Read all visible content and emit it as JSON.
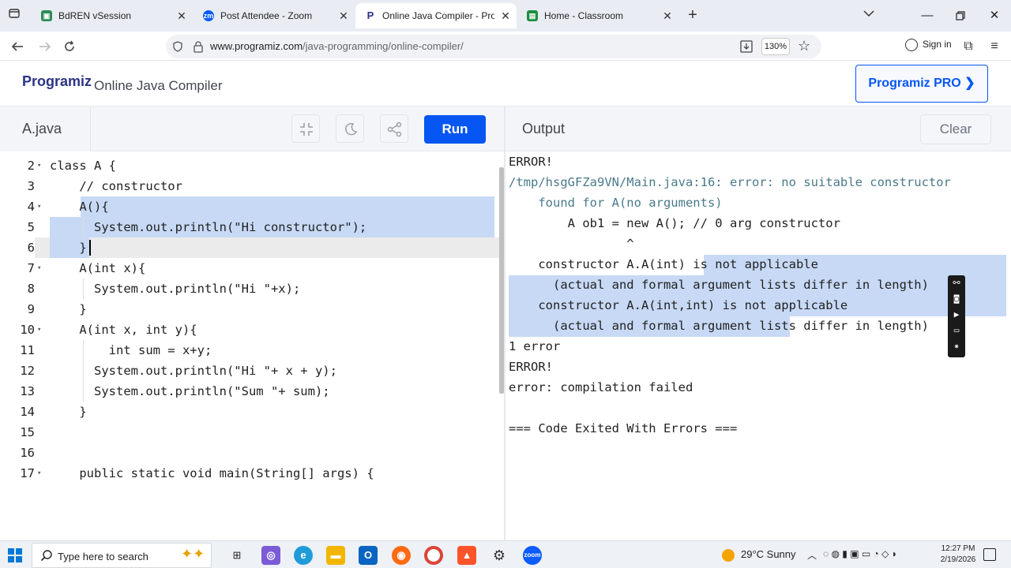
{
  "browser": {
    "tabs": [
      {
        "title": "BdREN vSession",
        "icon": "bdren-favicon-icon",
        "active": false,
        "color": "#2e8b57"
      },
      {
        "title": "Post Attendee - Zoom",
        "icon": "zoom-favicon-icon",
        "active": false,
        "color": "#0b5cff"
      },
      {
        "title": "Online Java Compiler - Programiz",
        "icon": "programiz-favicon-icon",
        "active": true,
        "color": "#2b3486"
      },
      {
        "title": "Home - Classroom",
        "icon": "classroom-favicon-icon",
        "active": false,
        "color": "#1e8e3e"
      }
    ],
    "url_domain": "www.programiz.com",
    "url_path": "/java-programming/online-compiler/",
    "zoom": "130%",
    "signin_label": "Sign in"
  },
  "site": {
    "logo": "Programiz",
    "title": "Online Java Compiler",
    "pro_button": "Programiz PRO ❯",
    "accent": "#0556f3"
  },
  "editor": {
    "filename": "A.java",
    "run_label": "Run",
    "lines": [
      {
        "num": "2",
        "fold": true,
        "text": "class A {"
      },
      {
        "num": "3",
        "fold": false,
        "text": "    // constructor"
      },
      {
        "num": "4",
        "fold": true,
        "text": "    A(){"
      },
      {
        "num": "5",
        "fold": false,
        "text": "      System.out.println(\"Hi constructor\");"
      },
      {
        "num": "6",
        "fold": false,
        "text": "    }"
      },
      {
        "num": "7",
        "fold": true,
        "text": "    A(int x){"
      },
      {
        "num": "8",
        "fold": false,
        "text": "      System.out.println(\"Hi \"+x);"
      },
      {
        "num": "9",
        "fold": false,
        "text": "    }"
      },
      {
        "num": "10",
        "fold": true,
        "text": "    A(int x, int y){"
      },
      {
        "num": "11",
        "fold": false,
        "text": "        int sum = x+y;"
      },
      {
        "num": "12",
        "fold": false,
        "text": "      System.out.println(\"Hi \"+ x + y);"
      },
      {
        "num": "13",
        "fold": false,
        "text": "      System.out.println(\"Sum \"+ sum);"
      },
      {
        "num": "14",
        "fold": false,
        "text": "    }"
      },
      {
        "num": "15",
        "fold": false,
        "text": ""
      },
      {
        "num": "16",
        "fold": false,
        "text": ""
      },
      {
        "num": "17",
        "fold": true,
        "text": "    public static void main(String[] args) {"
      }
    ]
  },
  "output": {
    "title": "Output",
    "clear_label": "Clear",
    "lines": [
      "ERROR!",
      "/tmp/hsgGFZa9VN/Main.java:16: error: no suitable constructor",
      "    found for A(no arguments)",
      "        A ob1 = new A(); // 0 arg constructor",
      "                ^",
      "    constructor A.A(int) is not applicable",
      "      (actual and formal argument lists differ in length)",
      "    constructor A.A(int,int) is not applicable",
      "      (actual and formal argument lists differ in length)",
      "1 error",
      "ERROR!",
      "error: compilation failed",
      "",
      "=== Code Exited With Errors ==="
    ]
  },
  "taskbar": {
    "search_placeholder": "Type here to search",
    "weather": "29°C  Sunny",
    "time": "12:27 PM",
    "date": "2/19/2026"
  }
}
